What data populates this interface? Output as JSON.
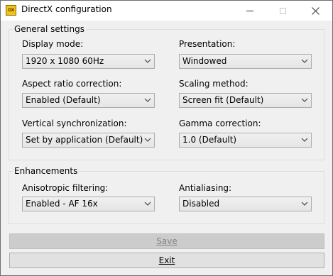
{
  "window": {
    "title": "DirectX configuration",
    "icon_text": "DX"
  },
  "general": {
    "legend": "General settings",
    "display_mode": {
      "label": "Display mode:",
      "value": "1920 x 1080  60Hz"
    },
    "presentation": {
      "label": "Presentation:",
      "value": "Windowed"
    },
    "aspect_ratio": {
      "label": "Aspect ratio correction:",
      "value": "Enabled (Default)"
    },
    "scaling": {
      "label": "Scaling method:",
      "value": "Screen fit (Default)"
    },
    "vsync": {
      "label": "Vertical synchronization:",
      "value": "Set by application (Default)"
    },
    "gamma": {
      "label": "Gamma correction:",
      "value": "1.0 (Default)"
    }
  },
  "enhancements": {
    "legend": "Enhancements",
    "anisotropic": {
      "label": "Anisotropic filtering:",
      "value": "Enabled - AF 16x"
    },
    "antialiasing": {
      "label": "Antialiasing:",
      "value": "Disabled"
    }
  },
  "buttons": {
    "save": "Save",
    "exit": "Exit"
  },
  "colors": {
    "window_bg": "#f0f0f0",
    "disabled_text": "#838383"
  }
}
